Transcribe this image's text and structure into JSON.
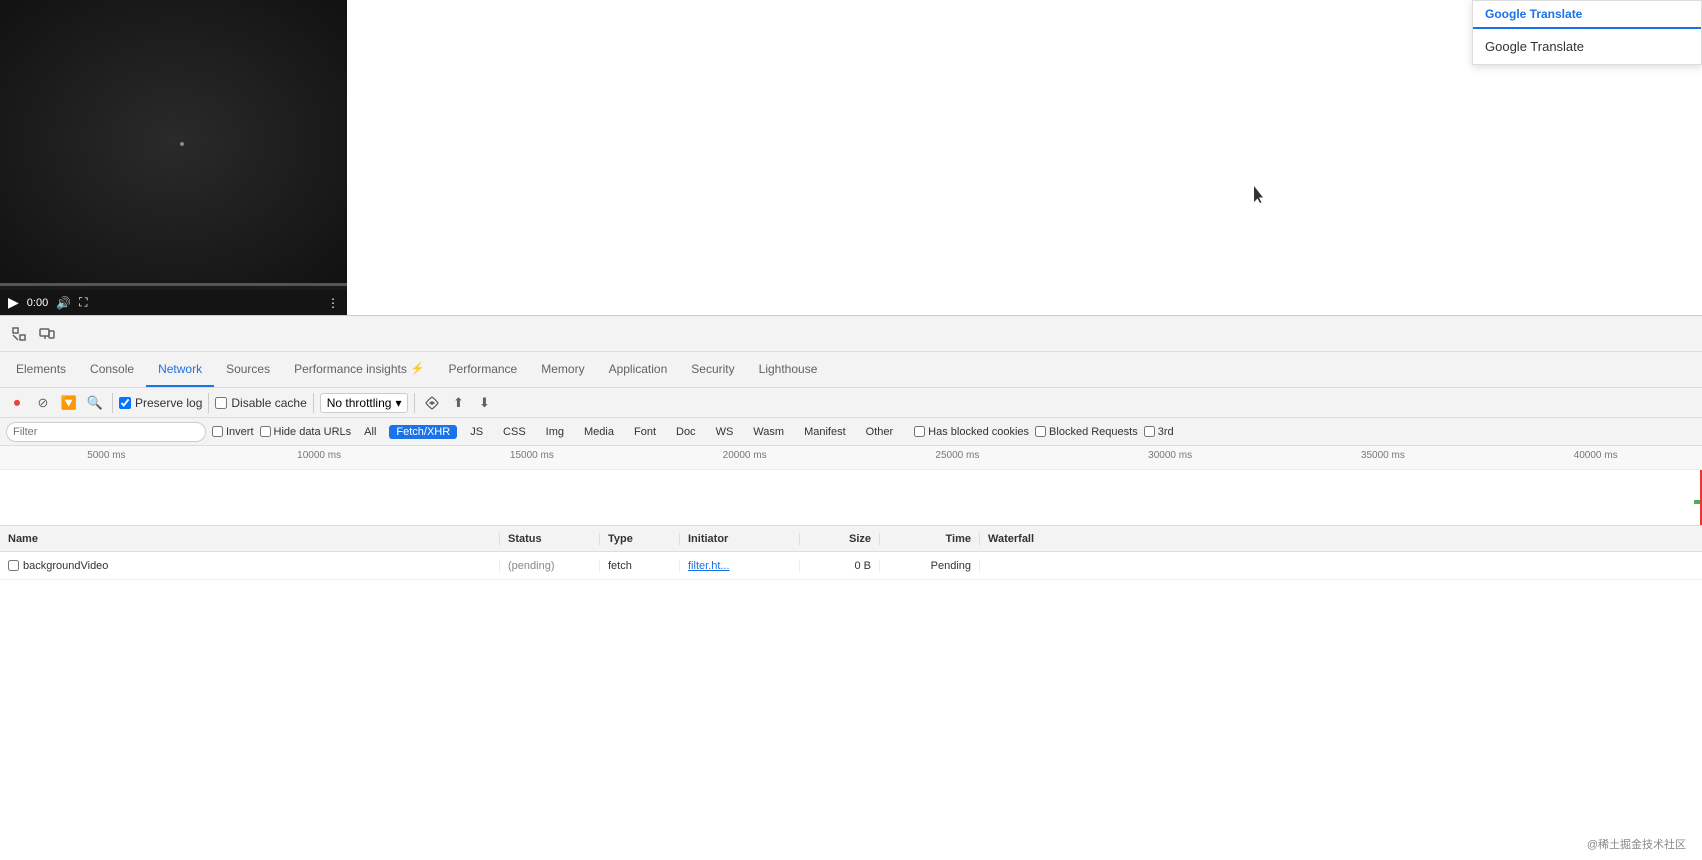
{
  "webpage": {
    "background": "#ffffff"
  },
  "google_translate": {
    "header_label": "Google Translate",
    "item_label": "Google Translate"
  },
  "devtools": {
    "tabs": [
      {
        "id": "elements",
        "label": "Elements",
        "active": false
      },
      {
        "id": "console",
        "label": "Console",
        "active": false
      },
      {
        "id": "network",
        "label": "Network",
        "active": true
      },
      {
        "id": "sources",
        "label": "Sources",
        "active": false
      },
      {
        "id": "performance-insights",
        "label": "Performance insights",
        "icon": "⚡",
        "active": false
      },
      {
        "id": "performance",
        "label": "Performance",
        "active": false
      },
      {
        "id": "memory",
        "label": "Memory",
        "active": false
      },
      {
        "id": "application",
        "label": "Application",
        "active": false
      },
      {
        "id": "security",
        "label": "Security",
        "active": false
      },
      {
        "id": "lighthouse",
        "label": "Lighthouse",
        "active": false
      }
    ],
    "network": {
      "toolbar": {
        "preserve_log_label": "Preserve log",
        "disable_cache_label": "Disable cache",
        "throttle_label": "No throttling",
        "preserve_log_checked": true,
        "disable_cache_checked": false
      },
      "filter": {
        "placeholder": "Filter",
        "invert_label": "Invert",
        "hide_data_urls_label": "Hide data URLs",
        "types": [
          "All",
          "Fetch/XHR",
          "JS",
          "CSS",
          "Img",
          "Media",
          "Font",
          "Doc",
          "WS",
          "Wasm",
          "Manifest",
          "Other"
        ],
        "active_type": "Fetch/XHR",
        "has_blocked_cookies_label": "Has blocked cookies",
        "blocked_requests_label": "Blocked Requests",
        "third_label": "3rd"
      },
      "timeline": {
        "labels": [
          "5000 ms",
          "10000 ms",
          "15000 ms",
          "20000 ms",
          "25000 ms",
          "30000 ms",
          "35000 ms",
          "40000 ms"
        ]
      },
      "table": {
        "headers": {
          "name": "Name",
          "status": "Status",
          "type": "Type",
          "initiator": "Initiator",
          "size": "Size",
          "time": "Time",
          "waterfall": "Waterfall"
        },
        "rows": [
          {
            "name": "backgroundVideo",
            "status": "(pending)",
            "type": "fetch",
            "initiator": "filter.ht...",
            "size": "0 B",
            "time": "Pending"
          }
        ]
      }
    }
  },
  "watermark": "@稀土掘金技术社区"
}
